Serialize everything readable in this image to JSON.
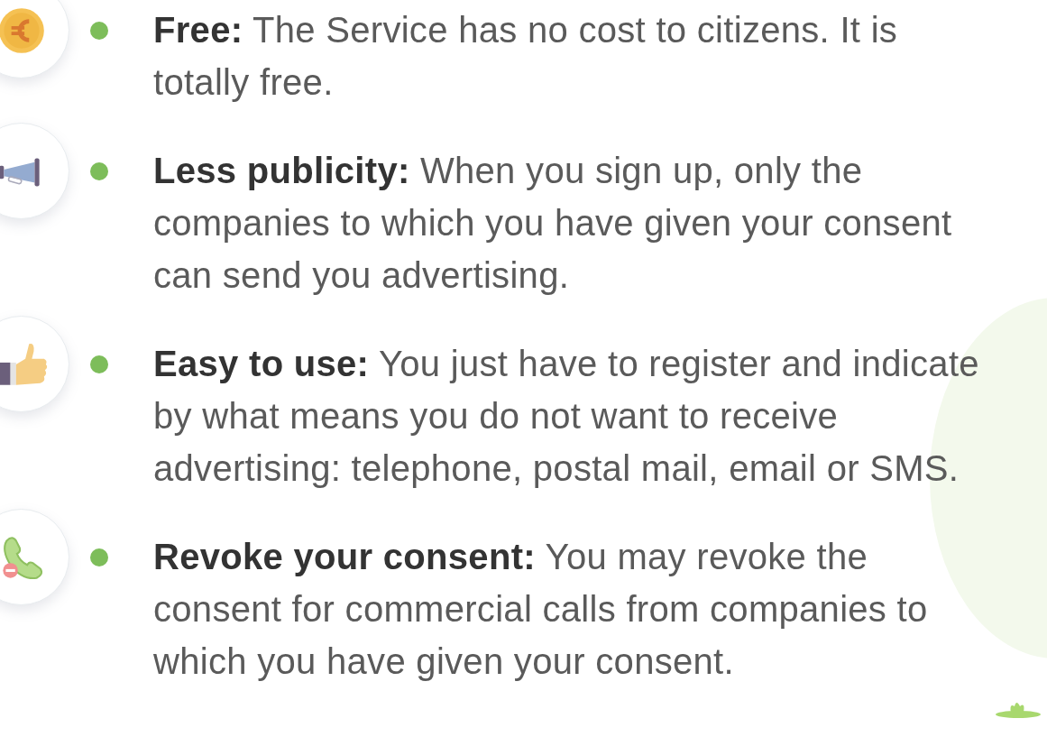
{
  "features": [
    {
      "text": "**Free:** The Service has no cost to citizens. It is totally free."
    },
    {
      "text": "**Less publicity:**  When you sign up, only the companies to which you have given your consent can send you advertising."
    },
    {
      "text": "**Easy to use:** You just have to register and indicate by what means you do not want to receive advertising: telephone, postal mail, email or SMS."
    },
    {
      "text": "**Revoke your consent:** You may revoke the consent for commercial calls from companies to which you have given your consent."
    }
  ]
}
